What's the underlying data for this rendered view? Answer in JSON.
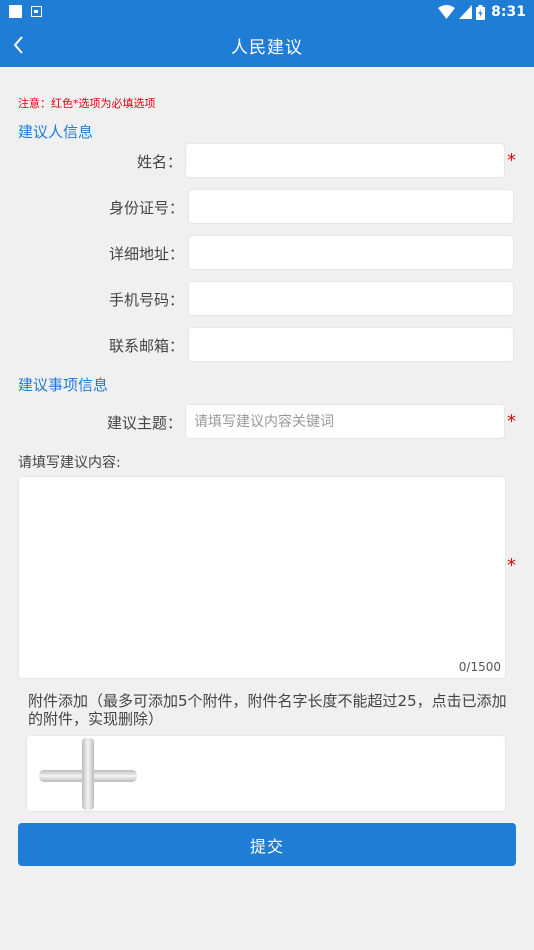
{
  "status_bar": {
    "time": "8:31"
  },
  "header": {
    "title": "人民建议",
    "back_icon": "back-arrow-icon"
  },
  "notice": "注意：红色*选项为必填选项",
  "sections": {
    "proposer": "建议人信息",
    "matter": "建议事项信息"
  },
  "fields": {
    "name": {
      "label": "姓名：",
      "value": ""
    },
    "id_number": {
      "label": "身份证号：",
      "value": ""
    },
    "address": {
      "label": "详细地址：",
      "value": ""
    },
    "phone": {
      "label": "手机号码：",
      "value": ""
    },
    "email": {
      "label": "联系邮箱：",
      "value": ""
    },
    "topic": {
      "label": "建议主题：",
      "placeholder": "请填写建议内容关键词",
      "value": ""
    }
  },
  "required_mark": "*",
  "content": {
    "label": "请填写建议内容:",
    "value": "",
    "counter": "0/1500"
  },
  "attachment": {
    "note": "附件添加（最多可添加5个附件，附件名字长度不能超过25，点击已添加的附件，实现删除）",
    "add_icon": "plus-icon"
  },
  "submit_label": "提交",
  "colors": {
    "primary": "#1f7dd6",
    "required": "#e60012",
    "background": "#f0f0f0"
  }
}
